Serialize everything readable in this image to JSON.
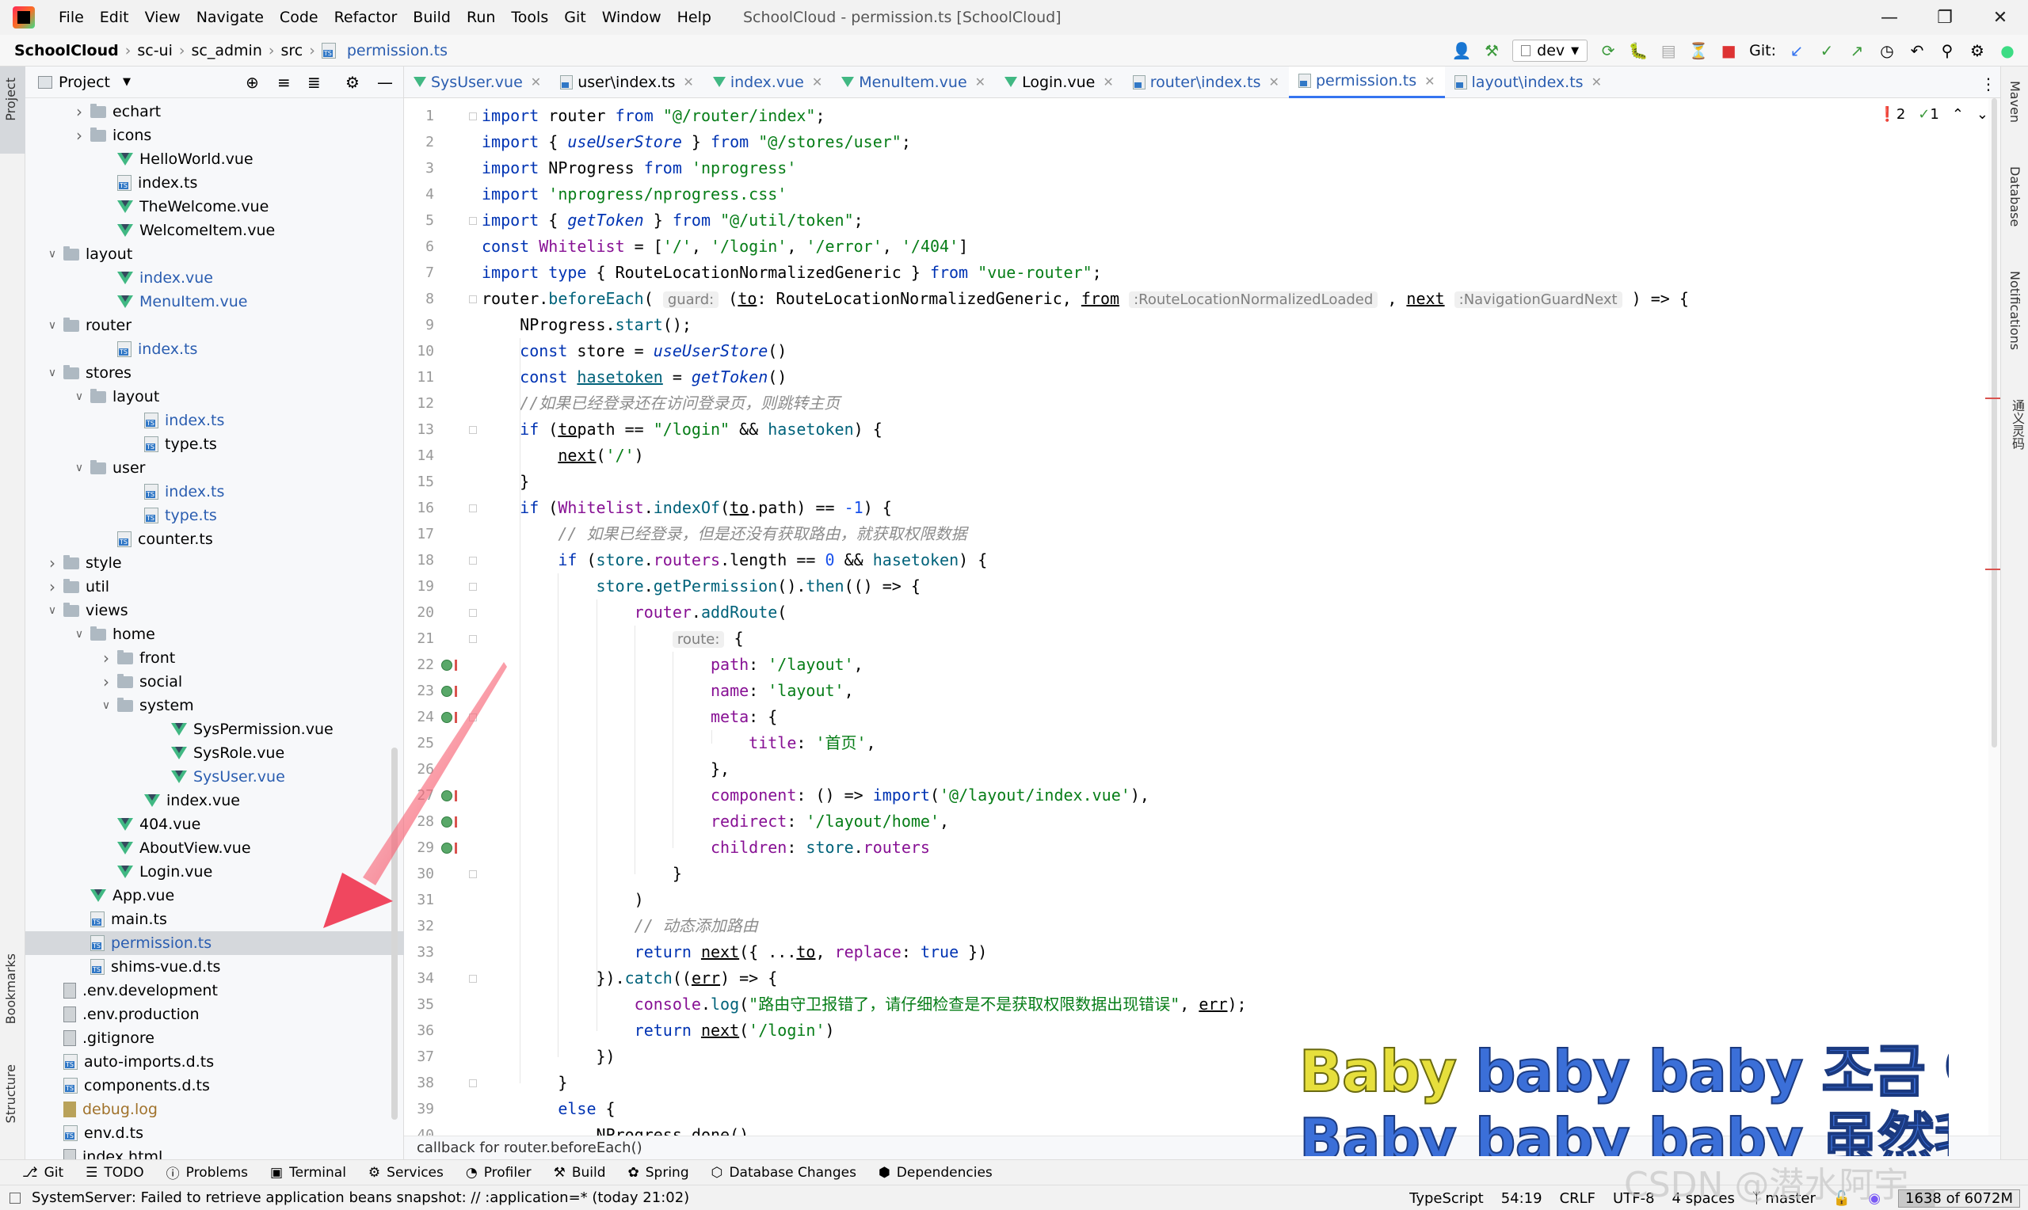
{
  "app": {
    "menu": [
      "File",
      "Edit",
      "View",
      "Navigate",
      "Code",
      "Refactor",
      "Build",
      "Run",
      "Tools",
      "Git",
      "Window",
      "Help"
    ],
    "window_title": "SchoolCloud - permission.ts [SchoolCloud]"
  },
  "nav": {
    "crumbs": [
      "SchoolCloud",
      "sc-ui",
      "sc_admin",
      "src",
      "permission.ts"
    ],
    "branch": "dev",
    "git_label": "Git:"
  },
  "project": {
    "title": "Project",
    "tree": [
      {
        "label": "echart",
        "type": "folder",
        "depth": 3,
        "expanded": false
      },
      {
        "label": "icons",
        "type": "folder",
        "depth": 3,
        "expanded": false
      },
      {
        "label": "HelloWorld.vue",
        "type": "vue",
        "depth": 4
      },
      {
        "label": "index.ts",
        "type": "ts",
        "depth": 4
      },
      {
        "label": "TheWelcome.vue",
        "type": "vue",
        "depth": 4
      },
      {
        "label": "WelcomeItem.vue",
        "type": "vue",
        "depth": 4
      },
      {
        "label": "layout",
        "type": "folder",
        "depth": 2,
        "expanded": true
      },
      {
        "label": "index.vue",
        "type": "vue",
        "depth": 4,
        "color": "blue"
      },
      {
        "label": "MenuItem.vue",
        "type": "vue",
        "depth": 4,
        "color": "blue"
      },
      {
        "label": "router",
        "type": "folder",
        "depth": 2,
        "expanded": true
      },
      {
        "label": "index.ts",
        "type": "ts",
        "depth": 4,
        "color": "blue"
      },
      {
        "label": "stores",
        "type": "folder",
        "depth": 2,
        "expanded": true
      },
      {
        "label": "layout",
        "type": "folder",
        "depth": 3,
        "expanded": true
      },
      {
        "label": "index.ts",
        "type": "ts",
        "depth": 5,
        "color": "blue"
      },
      {
        "label": "type.ts",
        "type": "ts",
        "depth": 5
      },
      {
        "label": "user",
        "type": "folder",
        "depth": 3,
        "expanded": true
      },
      {
        "label": "index.ts",
        "type": "ts",
        "depth": 5,
        "color": "blue"
      },
      {
        "label": "type.ts",
        "type": "ts",
        "depth": 5,
        "color": "blue"
      },
      {
        "label": "counter.ts",
        "type": "ts",
        "depth": 4
      },
      {
        "label": "style",
        "type": "folder",
        "depth": 2,
        "expanded": false
      },
      {
        "label": "util",
        "type": "folder",
        "depth": 2,
        "expanded": false
      },
      {
        "label": "views",
        "type": "folder",
        "depth": 2,
        "expanded": true
      },
      {
        "label": "home",
        "type": "folder",
        "depth": 3,
        "expanded": true
      },
      {
        "label": "front",
        "type": "folder",
        "depth": 4,
        "expanded": false
      },
      {
        "label": "social",
        "type": "folder",
        "depth": 4,
        "expanded": false
      },
      {
        "label": "system",
        "type": "folder",
        "depth": 4,
        "expanded": true
      },
      {
        "label": "SysPermission.vue",
        "type": "vue",
        "depth": 6
      },
      {
        "label": "SysRole.vue",
        "type": "vue",
        "depth": 6
      },
      {
        "label": "SysUser.vue",
        "type": "vue",
        "depth": 6,
        "color": "blue"
      },
      {
        "label": "index.vue",
        "type": "vue",
        "depth": 5
      },
      {
        "label": "404.vue",
        "type": "vue",
        "depth": 4
      },
      {
        "label": "AboutView.vue",
        "type": "vue",
        "depth": 4
      },
      {
        "label": "Login.vue",
        "type": "vue",
        "depth": 4
      },
      {
        "label": "App.vue",
        "type": "vue",
        "depth": 3
      },
      {
        "label": "main.ts",
        "type": "ts",
        "depth": 3
      },
      {
        "label": "permission.ts",
        "type": "ts",
        "depth": 3,
        "color": "blue",
        "selected": true
      },
      {
        "label": "shims-vue.d.ts",
        "type": "ts",
        "depth": 3
      },
      {
        "label": ".env.development",
        "type": "file",
        "depth": 2
      },
      {
        "label": ".env.production",
        "type": "file",
        "depth": 2
      },
      {
        "label": ".gitignore",
        "type": "file",
        "depth": 2
      },
      {
        "label": "auto-imports.d.ts",
        "type": "ts",
        "depth": 2
      },
      {
        "label": "components.d.ts",
        "type": "ts",
        "depth": 2
      },
      {
        "label": "debug.log",
        "type": "log",
        "depth": 2,
        "color": "orange"
      },
      {
        "label": "env.d.ts",
        "type": "ts",
        "depth": 2
      },
      {
        "label": "index.html",
        "type": "file",
        "depth": 2
      }
    ]
  },
  "tabs": [
    {
      "label": "SysUser.vue",
      "type": "vue",
      "color": "blue"
    },
    {
      "label": "user\\index.ts",
      "type": "ts"
    },
    {
      "label": "index.vue",
      "type": "vue",
      "color": "blue"
    },
    {
      "label": "MenuItem.vue",
      "type": "vue",
      "color": "blue"
    },
    {
      "label": "Login.vue",
      "type": "vue"
    },
    {
      "label": "router\\index.ts",
      "type": "ts",
      "color": "blue"
    },
    {
      "label": "permission.ts",
      "type": "ts",
      "color": "blue",
      "active": true
    },
    {
      "label": "layout\\index.ts",
      "type": "ts",
      "color": "blue"
    }
  ],
  "editor": {
    "error_count": "2",
    "warning_count": "1",
    "hint_text": "callback for router.beforeEach()",
    "code": [
      [
        [
          "kw",
          "import "
        ],
        [
          "",
          "router "
        ],
        [
          "kw",
          "from "
        ],
        [
          "str",
          "\"@/router/index\""
        ],
        [
          "",
          ";"
        ]
      ],
      [
        [
          "kw",
          "import "
        ],
        [
          "",
          "{ "
        ],
        [
          "bad",
          "useUserStore"
        ],
        [
          "",
          " } "
        ],
        [
          "kw",
          "from "
        ],
        [
          "str",
          "\"@/stores/user\""
        ],
        [
          "",
          ";"
        ]
      ],
      [
        [
          "kw",
          "import "
        ],
        [
          "",
          "NProgress "
        ],
        [
          "kw",
          "from "
        ],
        [
          "str",
          "'nprogress'"
        ]
      ],
      [
        [
          "kw",
          "import "
        ],
        [
          "str",
          "'nprogress/nprogress.css'"
        ]
      ],
      [
        [
          "kw",
          "import "
        ],
        [
          "",
          "{ "
        ],
        [
          "bad",
          "getToken"
        ],
        [
          "",
          " } "
        ],
        [
          "kw",
          "from "
        ],
        [
          "str",
          "\"@/util/token\""
        ],
        [
          "",
          ";"
        ]
      ],
      [
        [
          "kw",
          "const "
        ],
        [
          "prop",
          "Whitelist"
        ],
        [
          "",
          " = ["
        ],
        [
          "str",
          "'/'"
        ],
        [
          "",
          ", "
        ],
        [
          "str",
          "'/login'"
        ],
        [
          "",
          ", "
        ],
        [
          "str",
          "'/error'"
        ],
        [
          "",
          ", "
        ],
        [
          "str",
          "'/404'"
        ],
        [
          "",
          "]"
        ]
      ],
      [
        [
          "kw",
          "import type "
        ],
        [
          "",
          "{ RouteLocationNormalizedGeneric } "
        ],
        [
          "kw",
          "from "
        ],
        [
          "str",
          "\"vue-router\""
        ],
        [
          "",
          ";"
        ]
      ],
      [
        [
          "",
          "router."
        ],
        [
          "fn",
          "beforeEach"
        ],
        [
          "",
          "( "
        ],
        [
          "hint",
          "guard:"
        ],
        [
          "",
          " ("
        ],
        [
          "ul",
          "to"
        ],
        [
          "",
          ": RouteLocationNormalizedGeneric, "
        ],
        [
          "ul",
          "from"
        ],
        [
          "",
          " "
        ],
        [
          "hint",
          ":RouteLocationNormalizedLoaded"
        ],
        [
          "",
          " , "
        ],
        [
          "ul",
          "next"
        ],
        [
          "",
          " "
        ],
        [
          "hint",
          ":NavigationGuardNext"
        ],
        [
          "",
          " ) => {"
        ]
      ],
      [
        [
          "",
          "    NProgress."
        ],
        [
          "fn",
          "start"
        ],
        [
          "",
          "();"
        ]
      ],
      [
        [
          "kw",
          "    const "
        ],
        [
          "",
          "store = "
        ],
        [
          "bad",
          "useUserStore"
        ],
        [
          "",
          "()"
        ]
      ],
      [
        [
          "kw",
          "    const "
        ],
        [
          "ul fn",
          "hasetoken"
        ],
        [
          "",
          " = "
        ],
        [
          "bad",
          "getToken"
        ],
        [
          "",
          "()"
        ]
      ],
      [
        [
          "cmt",
          "    //如果已经登录还在访问登录页，则跳转主页"
        ]
      ],
      [
        [
          "kw",
          "    if "
        ],
        [
          "",
          "("
        ],
        [
          "ul",
          "to"
        ],
        [
          ".",
          ""
        ],
        [
          "",
          "path == "
        ],
        [
          "str",
          "\"/login\""
        ],
        [
          "",
          " && "
        ],
        [
          "fn",
          "hasetoken"
        ],
        [
          "",
          ") {"
        ]
      ],
      [
        [
          "",
          "        "
        ],
        [
          "ul",
          "next"
        ],
        [
          "",
          "("
        ],
        [
          "str",
          "'/'"
        ],
        [
          "",
          ")"
        ]
      ],
      [
        [
          "",
          "    }"
        ]
      ],
      [
        [
          "kw",
          "    if "
        ],
        [
          "",
          "("
        ],
        [
          "prop",
          "Whitelist"
        ],
        [
          "",
          "."
        ],
        [
          "fn",
          "indexOf"
        ],
        [
          "",
          "("
        ],
        [
          "ul",
          "to"
        ],
        [
          "",
          ".path) == "
        ],
        [
          "num",
          "-1"
        ],
        [
          "",
          ") {"
        ]
      ],
      [
        [
          "cmt",
          "        // 如果已经登录，但是还没有获取路由，就获取权限数据"
        ]
      ],
      [
        [
          "kw",
          "        if "
        ],
        [
          "",
          "("
        ],
        [
          "fn",
          "store"
        ],
        [
          "",
          "."
        ],
        [
          "prop",
          "routers"
        ],
        [
          "",
          ".length == "
        ],
        [
          "num",
          "0"
        ],
        [
          "",
          " && "
        ],
        [
          "fn",
          "hasetoken"
        ],
        [
          "",
          ") {"
        ]
      ],
      [
        [
          "fn",
          "            store"
        ],
        [
          "",
          "."
        ],
        [
          "fn",
          "getPermission"
        ],
        [
          "",
          "()."
        ],
        [
          "fn",
          "then"
        ],
        [
          "",
          "(() => {"
        ]
      ],
      [
        [
          "prop",
          "                router"
        ],
        [
          "",
          "."
        ],
        [
          "fn",
          "addRoute"
        ],
        [
          "",
          "("
        ]
      ],
      [
        [
          "",
          "                    "
        ],
        [
          "hint",
          "route:"
        ],
        [
          "",
          " {"
        ]
      ],
      [
        [
          "prop",
          "                        path"
        ],
        [
          "",
          ": "
        ],
        [
          "str",
          "'/layout'"
        ],
        [
          "",
          ","
        ]
      ],
      [
        [
          "prop",
          "                        name"
        ],
        [
          "",
          ": "
        ],
        [
          "str",
          "'layout'"
        ],
        [
          "",
          ","
        ]
      ],
      [
        [
          "prop",
          "                        meta"
        ],
        [
          "",
          ": {"
        ]
      ],
      [
        [
          "prop",
          "                            title"
        ],
        [
          "",
          ": "
        ],
        [
          "str",
          "'首页'"
        ],
        [
          "",
          ","
        ]
      ],
      [
        [
          "",
          "                        },"
        ]
      ],
      [
        [
          "prop",
          "                        component"
        ],
        [
          "",
          ": () => "
        ],
        [
          "kw",
          "import"
        ],
        [
          "",
          "("
        ],
        [
          "str",
          "'@/layout/index.vue'"
        ],
        [
          "",
          "),"
        ]
      ],
      [
        [
          "prop",
          "                        redirect"
        ],
        [
          "",
          ": "
        ],
        [
          "str",
          "'/layout/home'"
        ],
        [
          "",
          ","
        ]
      ],
      [
        [
          "prop",
          "                        children"
        ],
        [
          "",
          ": "
        ],
        [
          "fn",
          "store"
        ],
        [
          "",
          "."
        ],
        [
          "prop",
          "routers"
        ]
      ],
      [
        [
          "",
          "                    }"
        ]
      ],
      [
        [
          "",
          "                )"
        ]
      ],
      [
        [
          "cmt",
          "                // 动态添加路由"
        ]
      ],
      [
        [
          "kw",
          "                return "
        ],
        [
          "ul",
          "next"
        ],
        [
          "",
          "({ ..."
        ],
        [
          "ul",
          "to"
        ],
        [
          "",
          ", "
        ],
        [
          "prop",
          "replace"
        ],
        [
          "",
          ": "
        ],
        [
          "kw",
          "true"
        ],
        [
          "",
          " })"
        ]
      ],
      [
        [
          "",
          "            })."
        ],
        [
          "fn",
          "catch"
        ],
        [
          "",
          "(("
        ],
        [
          "ul",
          "err"
        ],
        [
          "",
          ") => {"
        ]
      ],
      [
        [
          "prop",
          "                console"
        ],
        [
          "",
          "."
        ],
        [
          "fn",
          "log"
        ],
        [
          "",
          "("
        ],
        [
          "str",
          "\"路由守卫报错了，请仔细检查是不是获取权限数据出现错误\""
        ],
        [
          "",
          ", "
        ],
        [
          "ul",
          "err"
        ],
        [
          "",
          ");"
        ]
      ],
      [
        [
          "kw",
          "                return "
        ],
        [
          "ul",
          "next"
        ],
        [
          "",
          "("
        ],
        [
          "str",
          "'/login'"
        ],
        [
          "",
          ")"
        ]
      ],
      [
        [
          "",
          "            })"
        ]
      ],
      [
        [
          "",
          "        }"
        ]
      ],
      [
        [
          "kw",
          "        else "
        ],
        [
          "",
          "{"
        ]
      ],
      [
        [
          "",
          "            NProgress.done()"
        ]
      ]
    ]
  },
  "toolwindows": [
    "Git",
    "TODO",
    "Problems",
    "Terminal",
    "Services",
    "Profiler",
    "Build",
    "Spring",
    "Database Changes",
    "Dependencies"
  ],
  "status": {
    "message": "SystemServer: Failed to retrieve application beans snapshot: // :application=* (today 21:02)",
    "language": "TypeScript",
    "position": "54:19",
    "line_sep": "CRLF",
    "encoding": "UTF-8",
    "indent": "4 spaces",
    "branch": "master",
    "memory": "1638 of 6072M"
  },
  "left_tabs": [
    "Project",
    "Bookmarks",
    "Structure"
  ],
  "right_tabs": [
    "Maven",
    "Database",
    "Notifications",
    "通义灵码"
  ],
  "overlay": {
    "lyric1_y": "Baby",
    "lyric1_rest": " baby baby 조금 어색",
    "lyric2": "Baby baby baby 虽然我们在",
    "watermark": "CSDN @潜水阿宇"
  },
  "colors": {
    "accent": "#3574f0",
    "arrow": "#f0475f",
    "vue": "#41b883",
    "ts": "#3178c6"
  }
}
